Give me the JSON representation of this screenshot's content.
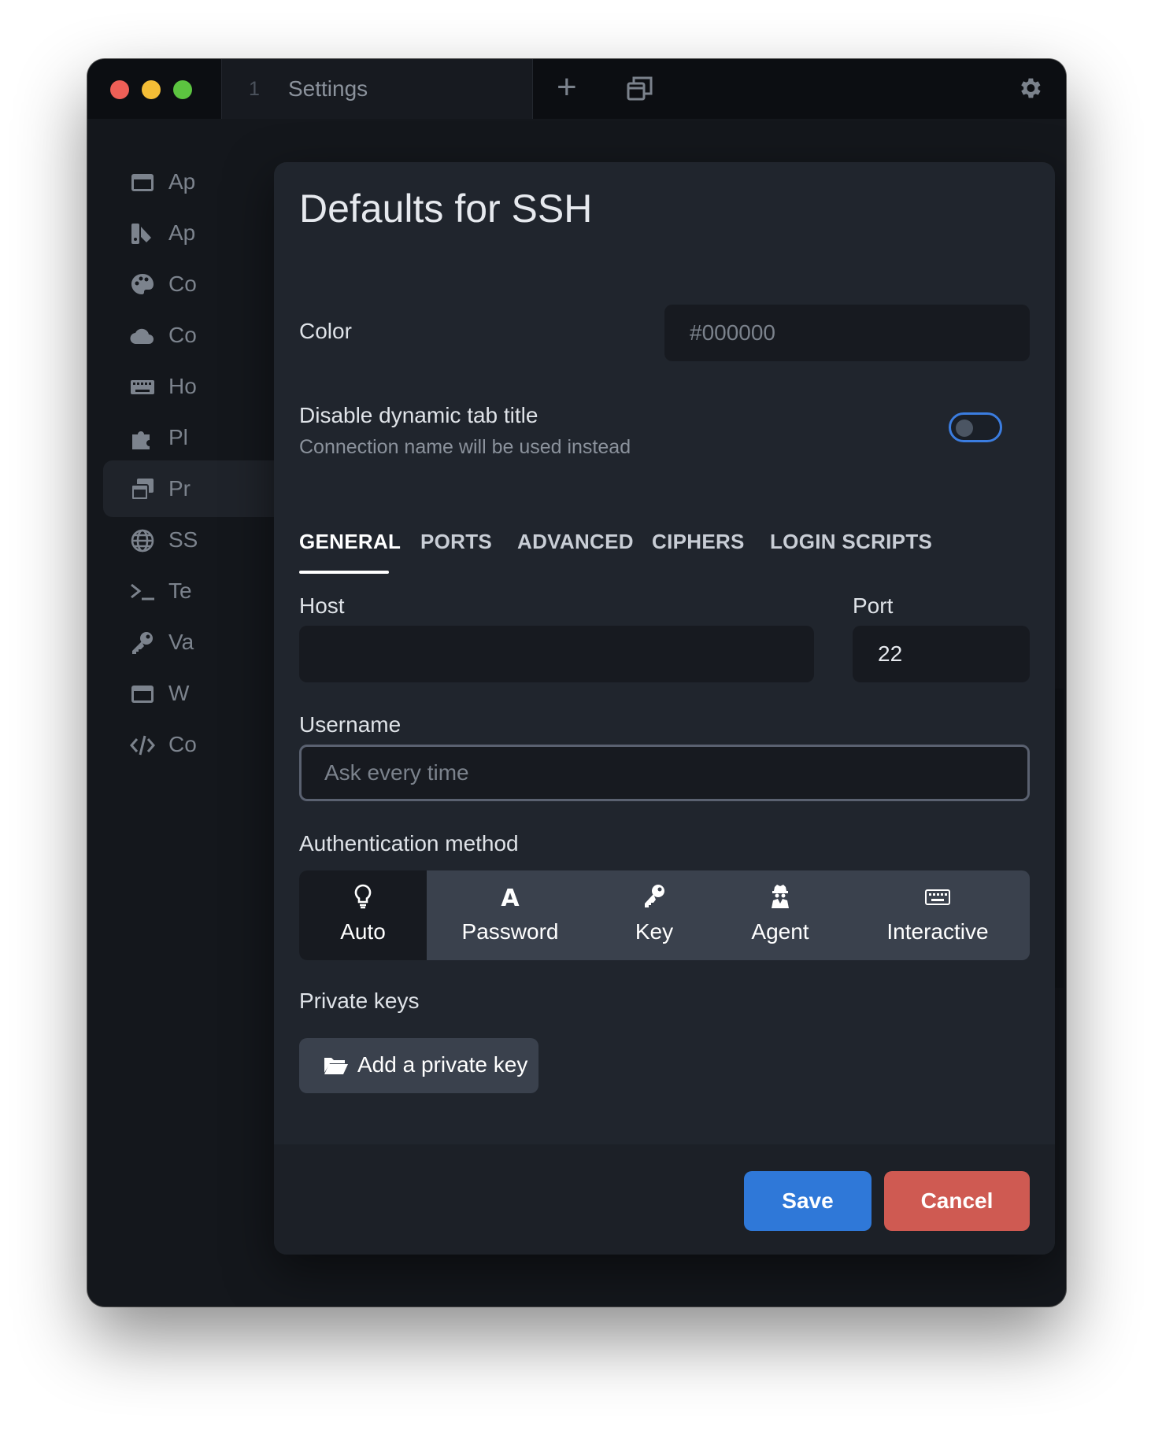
{
  "titlebar": {
    "tab_index": "1",
    "tab_title": "Settings"
  },
  "sidebar": {
    "items": [
      {
        "label": "Ap",
        "icon": "window-icon"
      },
      {
        "label": "Ap",
        "icon": "paint-bucket-icon"
      },
      {
        "label": "Co",
        "icon": "palette-icon"
      },
      {
        "label": "Co",
        "icon": "cloud-icon"
      },
      {
        "label": "Ho",
        "icon": "keyboard-icon"
      },
      {
        "label": "Pl",
        "icon": "puzzle-icon"
      },
      {
        "label": "Pr",
        "icon": "windows-icon"
      },
      {
        "label": "SS",
        "icon": "globe-icon"
      },
      {
        "label": "Te",
        "icon": "terminal-icon"
      },
      {
        "label": "Va",
        "icon": "key-icon"
      },
      {
        "label": "W",
        "icon": "window-icon"
      },
      {
        "label": "Co",
        "icon": "code-icon"
      }
    ]
  },
  "modal": {
    "title": "Defaults for SSH",
    "color_label": "Color",
    "color_placeholder": "#000000",
    "dynamic_title_label": "Disable dynamic tab title",
    "dynamic_title_sublabel": "Connection name will be used instead",
    "toggle_on": false,
    "tabs": [
      "GENERAL",
      "PORTS",
      "ADVANCED",
      "CIPHERS",
      "LOGIN SCRIPTS"
    ],
    "active_tab": "GENERAL",
    "host_label": "Host",
    "host_value": "",
    "port_label": "Port",
    "port_value": "22",
    "username_label": "Username",
    "username_placeholder": "Ask every time",
    "auth_label": "Authentication method",
    "auth_options": [
      {
        "label": "Auto",
        "icon": "lightbulb-icon",
        "selected": true
      },
      {
        "label": "Password",
        "icon": "letter-a-icon",
        "selected": false
      },
      {
        "label": "Key",
        "icon": "key-icon",
        "selected": false
      },
      {
        "label": "Agent",
        "icon": "user-secret-icon",
        "selected": false
      },
      {
        "label": "Interactive",
        "icon": "keyboard-icon",
        "selected": false
      }
    ],
    "private_keys_label": "Private keys",
    "add_key_label": "Add a private key",
    "save_label": "Save",
    "cancel_label": "Cancel"
  },
  "colors": {
    "accent": "#2f78d8",
    "danger": "#cf5a52"
  }
}
